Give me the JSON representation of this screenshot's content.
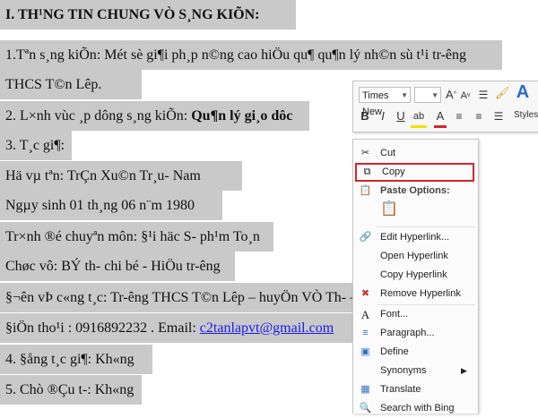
{
  "document": {
    "heading": "I. TH¹NG TIN CHUNG VÒ S¸NG KIÕN:",
    "line1a": "1.Tªn s¸ng kiÕn: Mét sè gi¶i ph¸p n©ng cao hiÖu qu¶ qu¶n lý nh©n sù t¹i tr-êng",
    "line1b": "THCS T©n Lêp.",
    "line2_prefix": "2. L×nh vùc ¸p dông s¸ng kiÕn: ",
    "line2_bold": "Qu¶n lý gi¸o dôc",
    "line3": "3. T¸c gi¶:",
    "line4": "Hä vµ tªn: TrÇn Xu©n Tr¸u- Nam",
    "line5": "Ngµy sinh 01 th¸ng 06 n¨m 1980",
    "line6": "Tr×nh ®é chuyªn môn: §¹i häc S- ph¹m To¸n",
    "line7": "Chøc vô: BÝ th- chi bé - HiÖu tr-êng",
    "line8": "§¬ên vÞ c«ng t¸c: Tr-êng THCS T©n Lêp – huyÖn VÒ Th- –",
    "line9_prefix": "§iÖn tho¹i : 0916892232 . Email: ",
    "line9_email": "c2tanlapvt@gmail.com",
    "line10": "4. §ång t¸c gi¶: Kh«ng",
    "line11": "5. Chò ®Çu t-: Kh«ng"
  },
  "mini_toolbar": {
    "font_name": "Times New",
    "buttons": [
      "B",
      "I",
      "U",
      "A",
      "A",
      "A"
    ],
    "styles_label": "Styles"
  },
  "context_menu": {
    "items": [
      {
        "icon": "scissors-icon",
        "label": "Cut"
      },
      {
        "icon": "copy-icon",
        "label": "Copy"
      },
      {
        "icon": "clipboard-icon",
        "label": "Paste Options:"
      },
      {
        "icon": "edit-hyperlink-icon",
        "label": "Edit Hyperlink..."
      },
      {
        "label": "Open Hyperlink"
      },
      {
        "label": "Copy Hyperlink"
      },
      {
        "icon": "remove-hyperlink-icon",
        "label": "Remove Hyperlink"
      },
      {
        "icon": "font-icon",
        "label": "Font..."
      },
      {
        "icon": "paragraph-icon",
        "label": "Paragraph..."
      },
      {
        "icon": "define-icon",
        "label": "Define"
      },
      {
        "label": "Synonyms"
      },
      {
        "icon": "translate-icon",
        "label": "Translate"
      },
      {
        "icon": "search-bing-icon",
        "label": "Search with Bing"
      }
    ]
  },
  "colors": {
    "selection": "#c9c9c9",
    "highlight_border": "#d0262c",
    "link": "#1a1aee"
  }
}
